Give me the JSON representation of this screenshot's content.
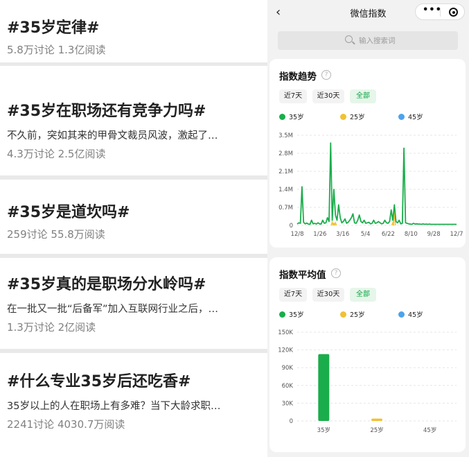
{
  "topics": [
    {
      "title": "#35岁定律#",
      "desc": "",
      "stats": "5.8万讨论 1.3亿阅读"
    },
    {
      "title": "#35岁在职场还有竞争力吗#",
      "desc": "不久前，突如其来的甲骨文裁员风波，激起了…",
      "stats": "4.3万讨论 2.5亿阅读"
    },
    {
      "title": "#35岁是道坎吗#",
      "desc": "",
      "stats": "259讨论 55.8万阅读"
    },
    {
      "title": "#35岁真的是职场分水岭吗#",
      "desc": "在一批又一批“后备军”加入互联网行业之后，…",
      "stats": "1.3万讨论 2亿阅读"
    },
    {
      "title": "#什么专业35岁后还吃香#",
      "desc": "35岁以上的人在职场上有多难？当下大龄求职…",
      "stats": "2241讨论 4030.7万阅读"
    }
  ],
  "nav": {
    "back_icon": "‹",
    "title": "微信指数",
    "more_icon": "•••"
  },
  "search": {
    "placeholder": "输入搜索词"
  },
  "trend_card": {
    "title": "指数趋势",
    "help_icon": "?",
    "tabs": [
      {
        "label": "近7天",
        "active": false
      },
      {
        "label": "近30天",
        "active": false
      },
      {
        "label": "全部",
        "active": true
      }
    ]
  },
  "avg_card": {
    "title": "指数平均值",
    "help_icon": "?",
    "tabs": [
      {
        "label": "近7天",
        "active": false
      },
      {
        "label": "近30天",
        "active": false
      },
      {
        "label": "全部",
        "active": true
      }
    ]
  },
  "colors": {
    "s35": "#1aad4b",
    "s25": "#f2c032",
    "s45": "#4ca3ec",
    "grid": "#e6e6e6",
    "axis_text": "#555555"
  },
  "chart_data": [
    {
      "type": "line",
      "title": "",
      "xlabel": "",
      "ylabel": "",
      "x_ticks": [
        "12/8",
        "1/26",
        "3/16",
        "5/4",
        "6/22",
        "8/10",
        "9/28",
        "12/7"
      ],
      "y_ticks": [
        "0",
        "0.7M",
        "1.4M",
        "2.1M",
        "2.8M",
        "3.5M"
      ],
      "ylim": [
        0,
        3500000
      ],
      "legend": [
        "35岁",
        "25岁",
        "45岁"
      ],
      "legend_placement": "top",
      "grid": true,
      "series": [
        {
          "name": "35岁",
          "x": [
            0,
            1,
            2,
            3,
            4,
            5,
            6,
            7,
            8,
            9,
            10,
            11,
            12,
            13,
            14,
            15,
            16,
            17,
            18,
            19,
            20,
            21,
            22,
            23,
            24,
            25,
            26,
            27,
            28,
            29,
            30,
            31,
            32,
            33,
            34,
            35,
            36,
            37,
            38,
            39,
            40,
            41,
            42,
            43,
            44,
            45,
            46,
            47,
            48,
            49,
            50,
            51,
            52,
            53,
            54,
            55,
            56,
            57,
            58,
            59,
            60,
            61,
            62,
            63,
            64,
            65,
            66,
            67,
            68,
            69,
            70,
            71,
            72,
            73,
            74,
            75,
            76,
            77,
            78,
            79,
            80,
            81,
            82,
            83,
            84,
            85,
            86,
            87,
            88,
            89,
            90,
            91,
            92,
            93,
            94,
            95,
            96,
            97,
            98,
            99,
            100
          ],
          "y": [
            50000,
            100000,
            80000,
            1500000,
            120000,
            60000,
            90000,
            50000,
            40000,
            200000,
            60000,
            80000,
            50000,
            100000,
            60000,
            50000,
            200000,
            80000,
            100000,
            300000,
            150000,
            3200000,
            200000,
            1400000,
            400000,
            200000,
            800000,
            300000,
            100000,
            150000,
            250000,
            80000,
            120000,
            200000,
            300000,
            450000,
            100000,
            80000,
            200000,
            400000,
            150000,
            100000,
            200000,
            80000,
            100000,
            120000,
            60000,
            80000,
            200000,
            80000,
            100000,
            150000,
            100000,
            60000,
            80000,
            200000,
            100000,
            80000,
            150000,
            600000,
            200000,
            800000,
            150000,
            100000,
            200000,
            60000,
            80000,
            3000000,
            100000,
            80000,
            60000,
            50000,
            40000,
            80000,
            50000,
            60000,
            50000,
            50000,
            40000,
            60000,
            40000,
            50000,
            40000,
            50000,
            40000,
            40000,
            40000,
            40000,
            40000,
            40000,
            40000,
            40000,
            40000,
            40000,
            40000,
            40000,
            40000,
            40000,
            40000,
            40000,
            40000
          ]
        },
        {
          "name": "25岁",
          "x": [
            22,
            23,
            24,
            60,
            61
          ],
          "y": [
            120000,
            80000,
            100000,
            100000,
            550000
          ]
        },
        {
          "name": "45岁",
          "x": [],
          "y": []
        }
      ]
    },
    {
      "type": "bar",
      "title": "",
      "xlabel": "",
      "ylabel": "",
      "categories": [
        "35岁",
        "25岁",
        "45岁"
      ],
      "y_ticks": [
        "0",
        "30K",
        "60K",
        "90K",
        "120K",
        "150K"
      ],
      "ylim": [
        0,
        150000
      ],
      "legend": [
        "35岁",
        "25岁",
        "45岁"
      ],
      "legend_placement": "top",
      "grid": true,
      "values": [
        113000,
        4000,
        0
      ]
    }
  ]
}
